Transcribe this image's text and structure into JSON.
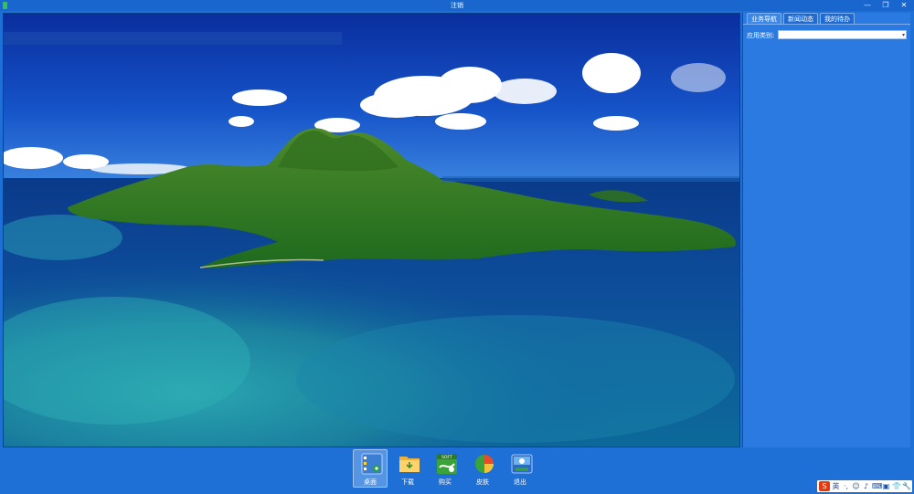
{
  "window": {
    "title": "注销",
    "minimize_glyph": "—",
    "restore_glyph": "❐",
    "close_glyph": "✕"
  },
  "panel": {
    "tabs": [
      {
        "label": "业务导航",
        "active": true
      },
      {
        "label": "新闻动态",
        "active": false
      },
      {
        "label": "我的待办",
        "active": false
      }
    ],
    "category_label": "应用类别:",
    "category_value": ""
  },
  "dock": {
    "items": [
      {
        "label": "桌面",
        "icon": "desktop-icon",
        "active": true
      },
      {
        "label": "下载",
        "icon": "download-folder-icon",
        "active": false
      },
      {
        "label": "购买",
        "icon": "soft-buy-icon",
        "active": false,
        "badge": "SOFT"
      },
      {
        "label": "皮肤",
        "icon": "skin-pie-icon",
        "active": false
      },
      {
        "label": "退出",
        "icon": "exit-icon",
        "active": false
      }
    ]
  },
  "tray": {
    "ime_glyph": "S",
    "lang": "英",
    "items": [
      "·,",
      "☺",
      "♪",
      "⌨",
      "▣",
      "👕",
      "🔧"
    ]
  },
  "colors": {
    "background": "#1e6fd6",
    "accent": "#2a7ae2"
  }
}
